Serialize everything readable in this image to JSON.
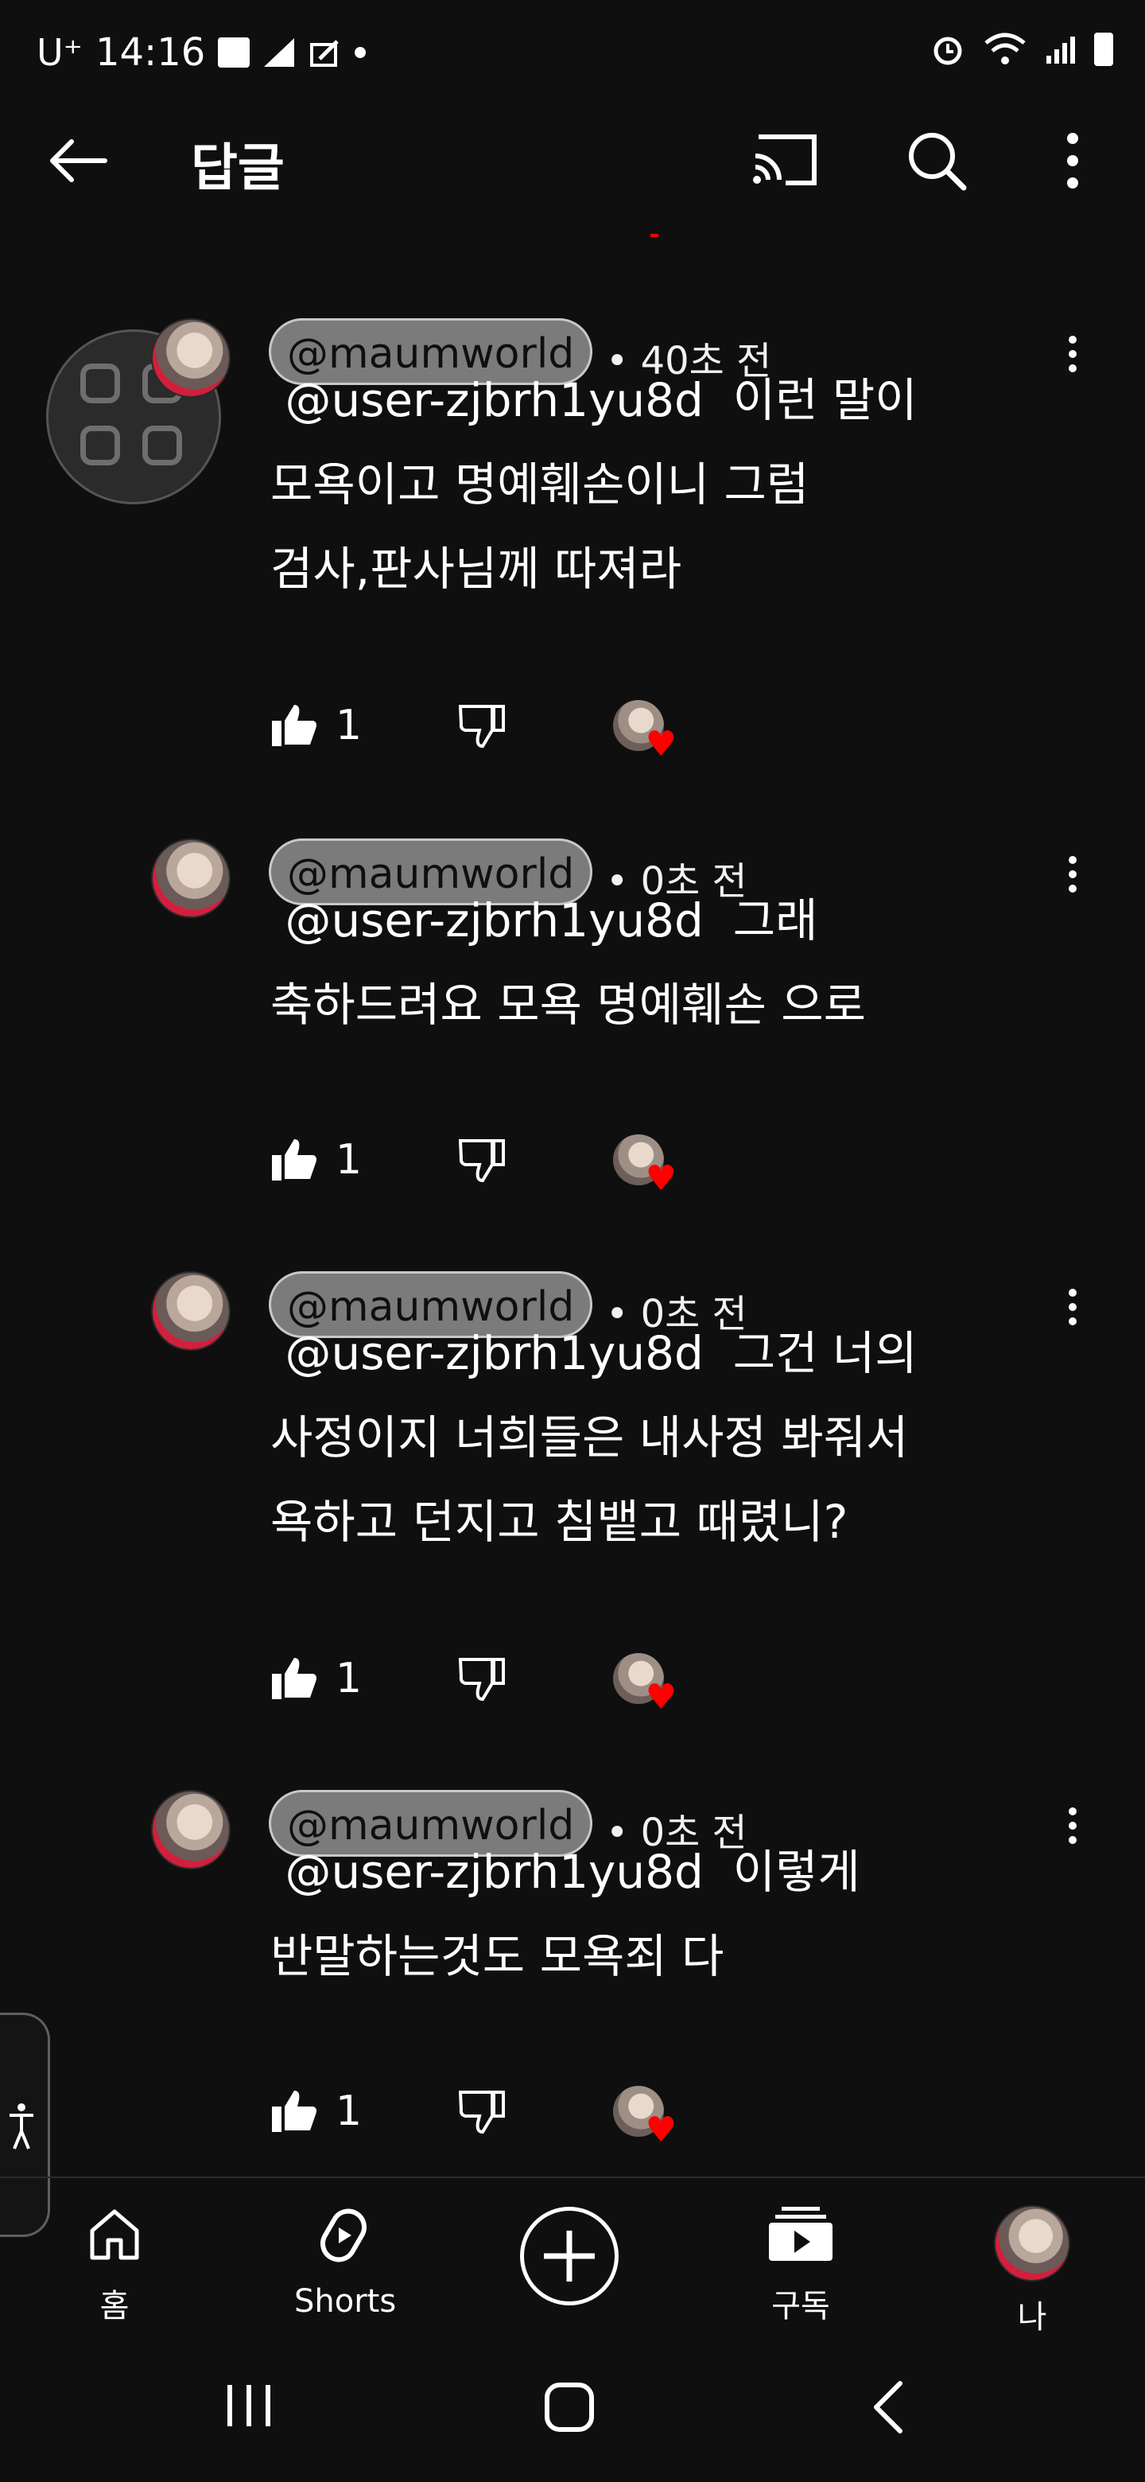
{
  "status_bar": {
    "carrier": "U⁺",
    "time": "14:16"
  },
  "app_bar": {
    "title": "답글"
  },
  "comments": [
    {
      "author": "@maumworld",
      "time": "• 40초 전",
      "mention": "@user-zjbrh1yu8d",
      "lines": [
        "이런 말이",
        "모욕이고 명예훼손이니 그럼",
        "검사,판사님께 따져라"
      ],
      "likes": "1"
    },
    {
      "author": "@maumworld",
      "time": "• 0초 전",
      "mention": "@user-zjbrh1yu8d",
      "lines": [
        "그래",
        "축하드려요 모욕 명예훼손 으로"
      ],
      "likes": "1"
    },
    {
      "author": "@maumworld",
      "time": "• 0초 전",
      "mention": "@user-zjbrh1yu8d",
      "lines": [
        "그건 너의",
        "사정이지 너희들은 내사정 봐줘서",
        "욕하고 던지고 침뱉고 때렸니?"
      ],
      "likes": "1"
    },
    {
      "author": "@maumworld",
      "time": "• 0초 전",
      "mention": "@user-zjbrh1yu8d",
      "lines": [
        "이렇게",
        "반말하는것도 모욕죄 다"
      ],
      "likes": "1"
    }
  ],
  "bottom_nav": {
    "home": "홈",
    "shorts": "Shorts",
    "subscriptions": "구독",
    "you": "나"
  },
  "icons": {
    "back": "arrow-left-icon",
    "cast": "cast-icon",
    "search": "search-icon",
    "more": "more-vert-icon",
    "like": "thumb-up-icon",
    "dislike": "thumb-down-icon",
    "heart": "heart-icon"
  },
  "colors": {
    "background": "#0f0f0f",
    "heart": "#ff0000",
    "pill": "#7b7b7b"
  }
}
